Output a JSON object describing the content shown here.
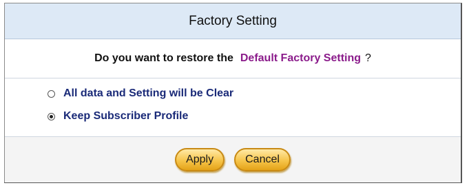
{
  "dialog": {
    "title": "Factory Setting",
    "question": {
      "prefix": "Do you want to restore the",
      "highlight": "Default Factory Setting",
      "suffix": "?"
    },
    "options": [
      {
        "label": "All data and Setting will be Clear",
        "selected": false
      },
      {
        "label": "Keep Subscriber Profile",
        "selected": true
      }
    ],
    "buttons": {
      "apply": "Apply",
      "cancel": "Cancel"
    }
  },
  "colors": {
    "title_bar": "#dde9f6",
    "highlight": "#8b1c8b",
    "option_text": "#1a2a78",
    "button_fill": "#f6c44a"
  }
}
